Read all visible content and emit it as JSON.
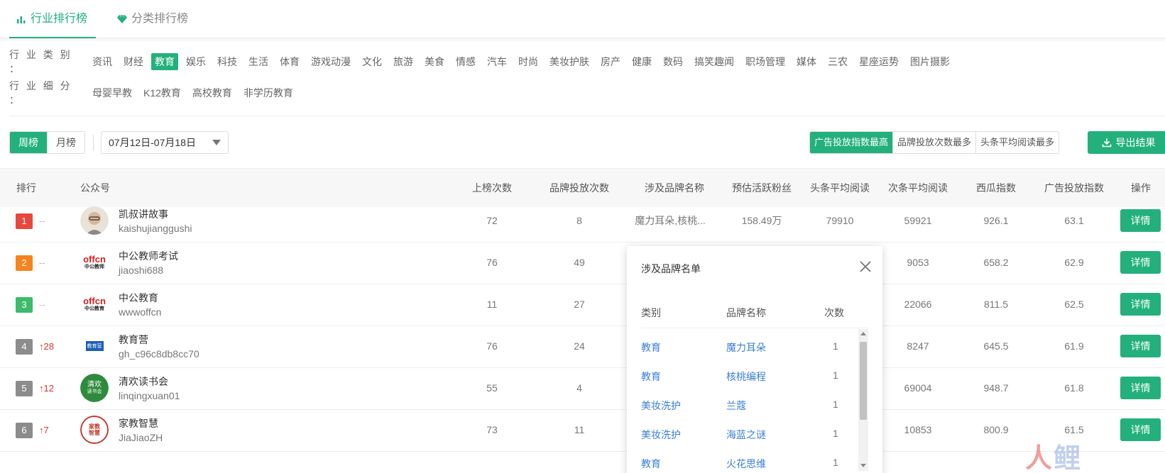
{
  "tabs": [
    {
      "label": "行业排行榜",
      "active": true
    },
    {
      "label": "分类排行榜",
      "active": false
    }
  ],
  "filters": {
    "category_label": "行 业 类 别 ：",
    "categories": [
      "资讯",
      "财经",
      "教育",
      "娱乐",
      "科技",
      "生活",
      "体育",
      "游戏动漫",
      "文化",
      "旅游",
      "美食",
      "情感",
      "汽车",
      "时尚",
      "美妆护肤",
      "房产",
      "健康",
      "数码",
      "搞笑趣闻",
      "职场管理",
      "媒体",
      "三农",
      "星座运势",
      "图片摄影"
    ],
    "category_active": "教育",
    "sub_label": "行 业 细 分 ：",
    "subcategories": [
      "母婴早教",
      "K12教育",
      "高校教育",
      "非学历教育"
    ]
  },
  "controls": {
    "period": [
      "周榜",
      "月榜"
    ],
    "period_active": "周榜",
    "date_range": "07月12日-07月18日",
    "sort_options": [
      "广告投放指数最高",
      "品牌投放次数最多",
      "头条平均阅读最多"
    ],
    "sort_active": "广告投放指数最高",
    "export_label": "导出结果"
  },
  "table": {
    "headers": {
      "rank": "排行",
      "account": "公众号",
      "appearances": "上榜次数",
      "brand_placements": "品牌投放次数",
      "brands": "涉及品牌名称",
      "active_fans": "预估活跃粉丝",
      "head_reads": "头条平均阅读",
      "sub_reads": "次条平均阅读",
      "xigua": "西瓜指数",
      "ad_index": "广告投放指数",
      "action": "操作"
    },
    "detail_label": "详情",
    "rows": [
      {
        "rank": "1",
        "change": "--",
        "change_dir": "none",
        "rank_color": "#e8473e",
        "name": "凯叔讲故事",
        "account": "kaishujianggushi",
        "appearances": "72",
        "brand_placements": "8",
        "brands": "魔力耳朵,核桃...",
        "active_fans": "158.49万",
        "head_reads": "79910",
        "sub_reads": "59921",
        "xigua": "926.1",
        "ad_index": "63.1"
      },
      {
        "rank": "2",
        "change": "--",
        "change_dir": "none",
        "rank_color": "#f5841f",
        "name": "中公教师考试",
        "account": "jiaoshi688",
        "appearances": "76",
        "brand_placements": "49",
        "brands": "",
        "active_fans": "",
        "head_reads": "",
        "sub_reads": "9053",
        "xigua": "658.2",
        "ad_index": "62.9"
      },
      {
        "rank": "3",
        "change": "--",
        "change_dir": "none",
        "rank_color": "#3dbb6a",
        "name": "中公教育",
        "account": "wwwoffcn",
        "appearances": "11",
        "brand_placements": "27",
        "brands": "",
        "active_fans": "",
        "head_reads": "",
        "sub_reads": "22066",
        "xigua": "811.5",
        "ad_index": "62.5"
      },
      {
        "rank": "4",
        "change": "↑28",
        "change_dir": "up",
        "rank_color": "#8c8c8c",
        "name": "教育营",
        "account": "gh_c96c8db8cc70",
        "appearances": "76",
        "brand_placements": "24",
        "brands": "",
        "active_fans": "",
        "head_reads": "",
        "sub_reads": "8247",
        "xigua": "645.5",
        "ad_index": "61.9"
      },
      {
        "rank": "5",
        "change": "↑12",
        "change_dir": "up",
        "rank_color": "#8c8c8c",
        "name": "清欢读书会",
        "account": "linqingxuan01",
        "appearances": "55",
        "brand_placements": "4",
        "brands": "",
        "active_fans": "",
        "head_reads": "",
        "sub_reads": "69004",
        "xigua": "948.7",
        "ad_index": "61.8"
      },
      {
        "rank": "6",
        "change": "↑7",
        "change_dir": "up",
        "rank_color": "#8c8c8c",
        "name": "家教智慧",
        "account": "JiaJiaoZH",
        "appearances": "73",
        "brand_placements": "11",
        "brands": "",
        "active_fans": "",
        "head_reads": "",
        "sub_reads": "10853",
        "xigua": "800.9",
        "ad_index": "61.5"
      }
    ]
  },
  "popup": {
    "title": "涉及品牌名单",
    "headers": {
      "category": "类别",
      "brand": "品牌名称",
      "count": "次数"
    },
    "rows": [
      {
        "category": "教育",
        "brand": "魔力耳朵",
        "count": "1"
      },
      {
        "category": "教育",
        "brand": "核桃编程",
        "count": "1"
      },
      {
        "category": "美妆洗护",
        "brand": "兰蔻",
        "count": "1"
      },
      {
        "category": "美妆洗护",
        "brand": "海蓝之谜",
        "count": "1"
      },
      {
        "category": "教育",
        "brand": "火花思维",
        "count": "1"
      }
    ]
  },
  "avatars": {
    "offcn_text": "offcn",
    "offcn_sub": "中公教师",
    "offcn_sub2": "中公教育",
    "edu_text": "教育营",
    "qingxuan_text": "清欢",
    "qingxuan_sub": "读书会",
    "jiajiao_text": "家教",
    "jiajiao_sub": "智慧"
  },
  "watermark": {
    "text1": "人",
    "text2": "鲤"
  },
  "colors": {
    "accent": "#23b07d",
    "link": "#3a7fd5",
    "up": "#d33"
  }
}
